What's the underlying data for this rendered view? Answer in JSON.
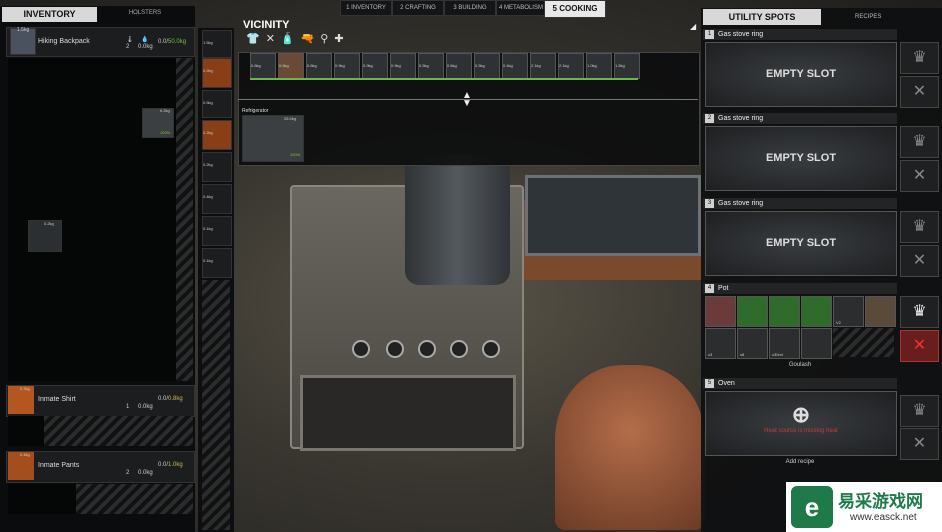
{
  "top_tabs": [
    {
      "label": "INVENTORY",
      "key": "1"
    },
    {
      "label": "CRAFTING",
      "key": "2"
    },
    {
      "label": "BUILDING",
      "key": "3"
    },
    {
      "label": "METABOLISM",
      "key": "4"
    },
    {
      "label": "COOKING",
      "key": "5",
      "active": true
    }
  ],
  "inventory": {
    "tab_label": "INVENTORY",
    "holsters_label": "HOLSTERS",
    "items": [
      {
        "name": "Hiking Backpack",
        "count": "2",
        "weight": "0.0kg",
        "capacity": "0.0/",
        "capacity_max": "50.0kg"
      },
      {
        "name": "Inmate Shirt",
        "count": "1",
        "weight": "0.0kg",
        "capacity": "0.0/",
        "capacity_max": "0.8kg"
      },
      {
        "name": "Inmate Pants",
        "count": "2",
        "weight": "0.0kg",
        "capacity": "0.0/",
        "capacity_max": "1.0kg"
      }
    ],
    "backpack_weight": "1.5kg",
    "loose_item_weight": "0.2kg",
    "paper_weight": "0.2kg",
    "paper_durability": "100%",
    "shirt_weight": "0.2kg",
    "pants_weight": "0.4kg",
    "equip_weights": [
      "1.5kg",
      "0.2kg",
      "0.5kg",
      "0.2kg",
      "0.2kg",
      "0.4kg",
      "0.1kg",
      "0.1kg"
    ]
  },
  "vicinity": {
    "title": "VICINITY",
    "items_weights": [
      "0.8kg",
      "0.5kg",
      "0.8kg",
      "0.9kg",
      "0.9kg",
      "0.9kg",
      "0.5kg",
      "0.6kg",
      "0.5kg",
      "0.4kg",
      "2.1kg",
      "2.1kg",
      "1.0kg",
      "1.5kg"
    ],
    "container_name": "Refrigerator",
    "container_weight": "25.0kg",
    "container_durability": "100%"
  },
  "utility": {
    "tab_label": "UTILITY SPOTS",
    "recipes_label": "RECIPES",
    "spots": [
      {
        "num": "1",
        "name": "Gas stove ring",
        "content": "EMPTY SLOT"
      },
      {
        "num": "2",
        "name": "Gas stove ring",
        "content": "EMPTY SLOT"
      },
      {
        "num": "3",
        "name": "Gas stove ring",
        "content": "EMPTY SLOT"
      },
      {
        "num": "4",
        "name": "Pot",
        "recipe": "Goulash"
      },
      {
        "num": "5",
        "name": "Oven",
        "warning": "Heat source is missing heat",
        "recipe": "Add recipe"
      }
    ],
    "pot_counts": [
      "V2",
      "x3",
      "x8",
      "x30ml"
    ]
  },
  "watermark": {
    "domain": "www.easck.net",
    "brand_cn": "易采游戏网"
  },
  "colors": {
    "accent_green": "#6bb843",
    "warning_red": "#c23b3b"
  }
}
